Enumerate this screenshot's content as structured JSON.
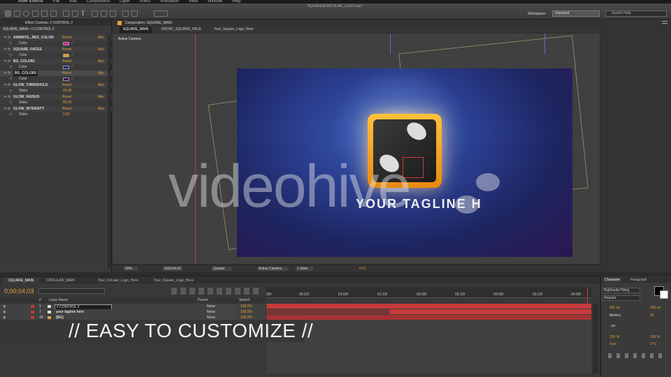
{
  "app": {
    "menu": [
      "After Effects",
      "File",
      "Edit",
      "Composition",
      "Layer",
      "Effect",
      "Animation",
      "View",
      "Window",
      "Help"
    ],
    "document_title": "SQUARE&CIRCULAR_LOGO.aep *",
    "workspace_label": "Workspace:",
    "workspace_value": "Standard",
    "search_placeholder": "Search Help"
  },
  "project_panel": {
    "tab_label": "Effect Controls: // CONTROL //",
    "breadcrumb": "SQUARE_MAIN • // CONTROL //",
    "effects": [
      {
        "name": "ANIMATE...RES_COLOR",
        "reset": "Reset",
        "about": "Abo",
        "prop": "Color",
        "color": "#e81a8a"
      },
      {
        "name": "SQUARE_FACES",
        "reset": "Reset",
        "about": "Abo",
        "prop": "Color",
        "color": "#e8a01a"
      },
      {
        "name": "BG_COLOR1",
        "reset": "Reset",
        "about": "Abo",
        "prop": "Color",
        "color": "#1a2a8a"
      },
      {
        "name": "BG_COLOR2",
        "reset": "Reset",
        "about": "Abo",
        "prop": "Color",
        "color": "#3a0a5a"
      },
      {
        "name": "GLOW_THRESHOLD",
        "reset": "Reset",
        "about": "Abo",
        "prop": "Slider",
        "value": "85.00"
      },
      {
        "name": "GLOW_RADIUS",
        "reset": "Reset",
        "about": "Abo",
        "prop": "Slider",
        "value": "85.00"
      },
      {
        "name": "GLOW_INTENSITY",
        "reset": "Reset",
        "about": "Abo",
        "prop": "Slider",
        "value": "0.30"
      }
    ]
  },
  "composition_panel": {
    "tab_label": "Composition: SQUARE_MAIN",
    "tabs": [
      "SQUARE_MAIN",
      "FRONT_SQUARE_FACE",
      "Your_Square_Logo_Here"
    ],
    "view_label": "Active Camera",
    "tagline": "YOUR TAGLINE H",
    "watermark": "videohive",
    "footer": {
      "zoom": "50%",
      "timecode": "0;00;04;03",
      "resolution": "Quarter",
      "camera": "Active Camera",
      "views": "1 View",
      "exposure": "+0.0"
    }
  },
  "timeline": {
    "tabs": [
      "SQUARE_MAIN",
      "CIRCULAR_MAIN",
      "Your_Circular_Logo_Here",
      "Your_Square_Logo_Here"
    ],
    "timecode": "0;00;04;03",
    "columns": [
      "#",
      "Layer Name",
      "Parent",
      "Stretch"
    ],
    "ruler": [
      "00f",
      "00:12f",
      "01:00f",
      "01:12f",
      "02:00f",
      "02:12f",
      "03:00f",
      "03:12f",
      "04:00f"
    ],
    "layers": [
      {
        "num": "1",
        "name": "// CONTROL //",
        "parent": "None",
        "stretch": "100.0%"
      },
      {
        "num": "7",
        "name": "your tagline here",
        "parent": "None",
        "stretch": "100.0%"
      },
      {
        "num": "39",
        "name": "[BG]",
        "parent": "None",
        "stretch": "100.0%"
      }
    ]
  },
  "character_panel": {
    "tabs": [
      "Character",
      "Paragraph"
    ],
    "font": "BigNoodleTitling",
    "style": "Regular",
    "size": "401 px",
    "leading": "293 px",
    "kerning": "Metrics",
    "tracking": "92",
    "stroke": "- px",
    "vscale": "100 %",
    "hscale": "100 %",
    "baseline": "0 px",
    "tsume": "0 %",
    "fill_color": "#000000"
  },
  "caption": "// EASY TO CUSTOMIZE //"
}
